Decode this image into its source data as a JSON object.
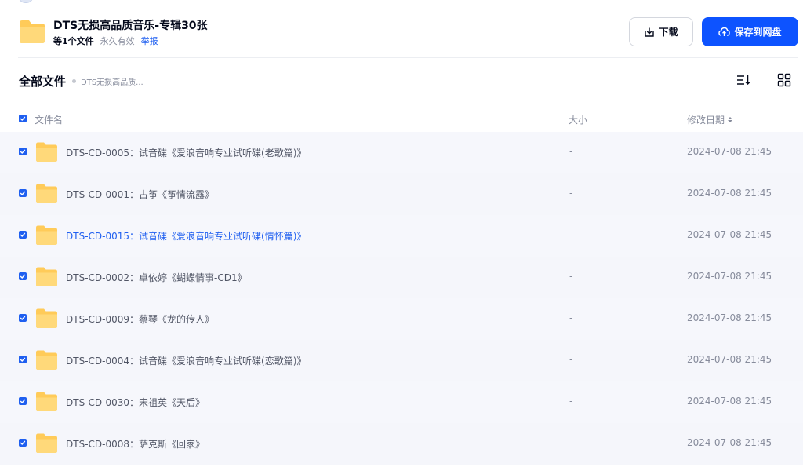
{
  "share": {
    "title": "DTS无损高品质音乐-专辑30张",
    "file_count": "等1个文件",
    "validity": "永久有效",
    "report_label": "举报"
  },
  "actions": {
    "download_label": "下载",
    "save_label": "保存到网盘",
    "primary_color": "#0d53ff"
  },
  "breadcrumb": {
    "root": "全部文件",
    "current": "DTS无损高品质..."
  },
  "toolbar": {
    "sort_icon": "sort-list-icon",
    "view_icon": "grid-view-icon"
  },
  "columns": {
    "name": "文件名",
    "size": "大小",
    "modified": "修改日期"
  },
  "files": [
    {
      "name": "DTS-CD-0005：试音碟《爱浪音响专业试听碟(老歌篇)》",
      "size": "-",
      "modified": "2024-07-08 21:45",
      "checked": true
    },
    {
      "name": "DTS-CD-0001：古筝《筝情流露》",
      "size": "-",
      "modified": "2024-07-08 21:45",
      "checked": true
    },
    {
      "name": "DTS-CD-0015：试音碟《爱浪音响专业试听碟(情怀篇)》",
      "size": "-",
      "modified": "2024-07-08 21:45",
      "checked": true
    },
    {
      "name": "DTS-CD-0002：卓依婷《蝴蝶情事-CD1》",
      "size": "-",
      "modified": "2024-07-08 21:45",
      "checked": true
    },
    {
      "name": "DTS-CD-0009：蔡琴《龙的传人》",
      "size": "-",
      "modified": "2024-07-08 21:45",
      "checked": true
    },
    {
      "name": "DTS-CD-0004：试音碟《爱浪音响专业试听碟(恋歌篇)》",
      "size": "-",
      "modified": "2024-07-08 21:45",
      "checked": true
    },
    {
      "name": "DTS-CD-0030：宋祖英《天后》",
      "size": "-",
      "modified": "2024-07-08 21:45",
      "checked": true
    },
    {
      "name": "DTS-CD-0008：萨克斯《回家》",
      "size": "-",
      "modified": "2024-07-08 21:45",
      "checked": true
    }
  ]
}
